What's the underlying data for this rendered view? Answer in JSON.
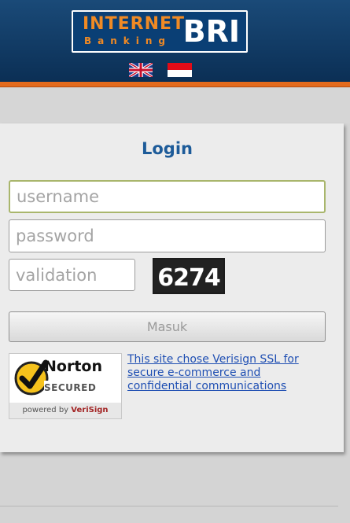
{
  "header": {
    "logo": {
      "word1": "INTERNET",
      "word2": "Banking",
      "word3": "BRI"
    },
    "languages": [
      {
        "code": "en",
        "icon": "uk-flag-icon"
      },
      {
        "code": "id",
        "icon": "indonesia-flag-icon"
      }
    ]
  },
  "login": {
    "title": "Login",
    "username_placeholder": "username",
    "password_placeholder": "password",
    "validation_placeholder": "validation",
    "captcha_code": "6274",
    "submit_label": "Masuk"
  },
  "security": {
    "badge_brand": "Norton",
    "badge_secured": "SECURED",
    "badge_powered": "powered by",
    "badge_vendor": "VeriSign",
    "ssl_text": "This site chose Verisign SSL for secure e-commerce and confidential communications"
  },
  "colors": {
    "header": "#0b2f55",
    "accent": "#e46b1d",
    "title": "#1d5b99",
    "link": "#1f4fb3"
  }
}
